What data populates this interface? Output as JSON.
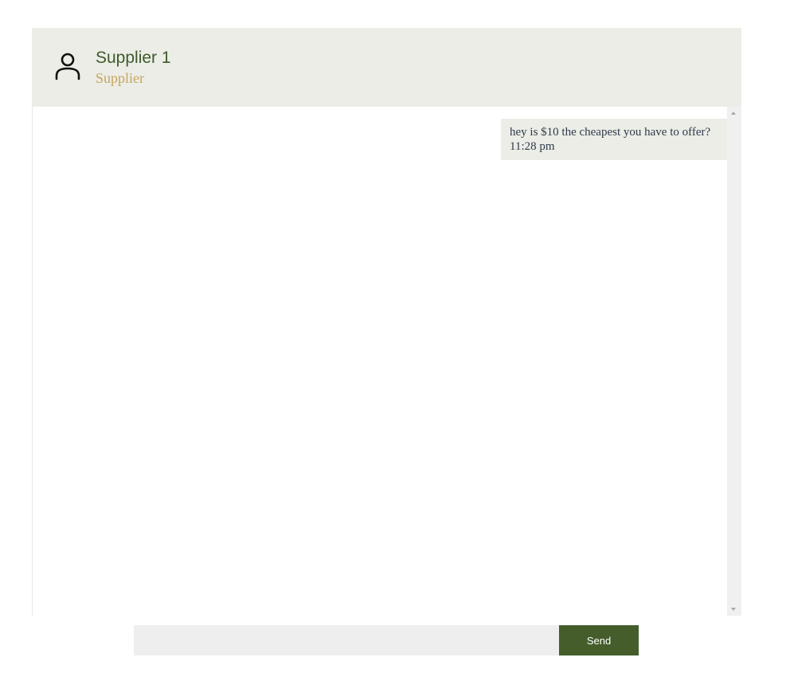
{
  "header": {
    "name": "Supplier 1",
    "role": "Supplier",
    "avatar_icon": "user-icon"
  },
  "messages": [
    {
      "text": "hey is $10 the cheapest you have to offer?",
      "time": "11:28 pm",
      "direction": "outgoing"
    }
  ],
  "composer": {
    "value": "",
    "placeholder": "",
    "send_label": "Send"
  },
  "colors": {
    "accent": "#445d2b",
    "name": "#3f5a2b",
    "role": "#c9a45f",
    "header_bg": "#ebede6",
    "bubble_bg": "#ebede6"
  }
}
